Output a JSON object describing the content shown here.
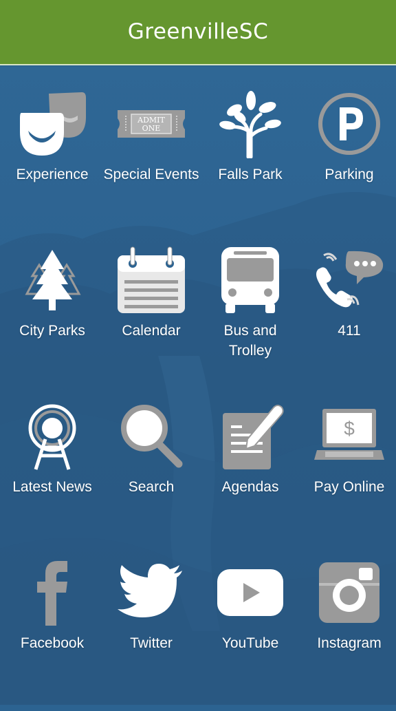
{
  "header": {
    "title": "GreenvilleSC"
  },
  "colors": {
    "header": "#65962f",
    "background": "#2c6391",
    "icon_gray": "#9a9a9a",
    "icon_white": "#ffffff"
  },
  "tiles": [
    {
      "label": "Experience",
      "icon": "theater-masks-icon"
    },
    {
      "label": "Special Events",
      "icon": "admit-one-ticket-icon"
    },
    {
      "label": "Falls Park",
      "icon": "tree-icon"
    },
    {
      "label": "Parking",
      "icon": "parking-icon"
    },
    {
      "label": "City Parks",
      "icon": "pine-trees-icon"
    },
    {
      "label": "Calendar",
      "icon": "calendar-icon"
    },
    {
      "label": "Bus and Trolley",
      "icon": "bus-icon"
    },
    {
      "label": "411",
      "icon": "phone-chat-icon"
    },
    {
      "label": "Latest News",
      "icon": "broadcast-tower-icon"
    },
    {
      "label": "Search",
      "icon": "magnifier-icon"
    },
    {
      "label": "Agendas",
      "icon": "document-pen-icon"
    },
    {
      "label": "Pay Online",
      "icon": "laptop-dollar-icon"
    },
    {
      "label": "Facebook",
      "icon": "facebook-icon"
    },
    {
      "label": "Twitter",
      "icon": "twitter-bird-icon"
    },
    {
      "label": "YouTube",
      "icon": "youtube-icon"
    },
    {
      "label": "Instagram",
      "icon": "instagram-icon"
    }
  ],
  "icon_text": {
    "ticket_line1": "ADMIT",
    "ticket_line2": "ONE",
    "dollar": "$"
  }
}
